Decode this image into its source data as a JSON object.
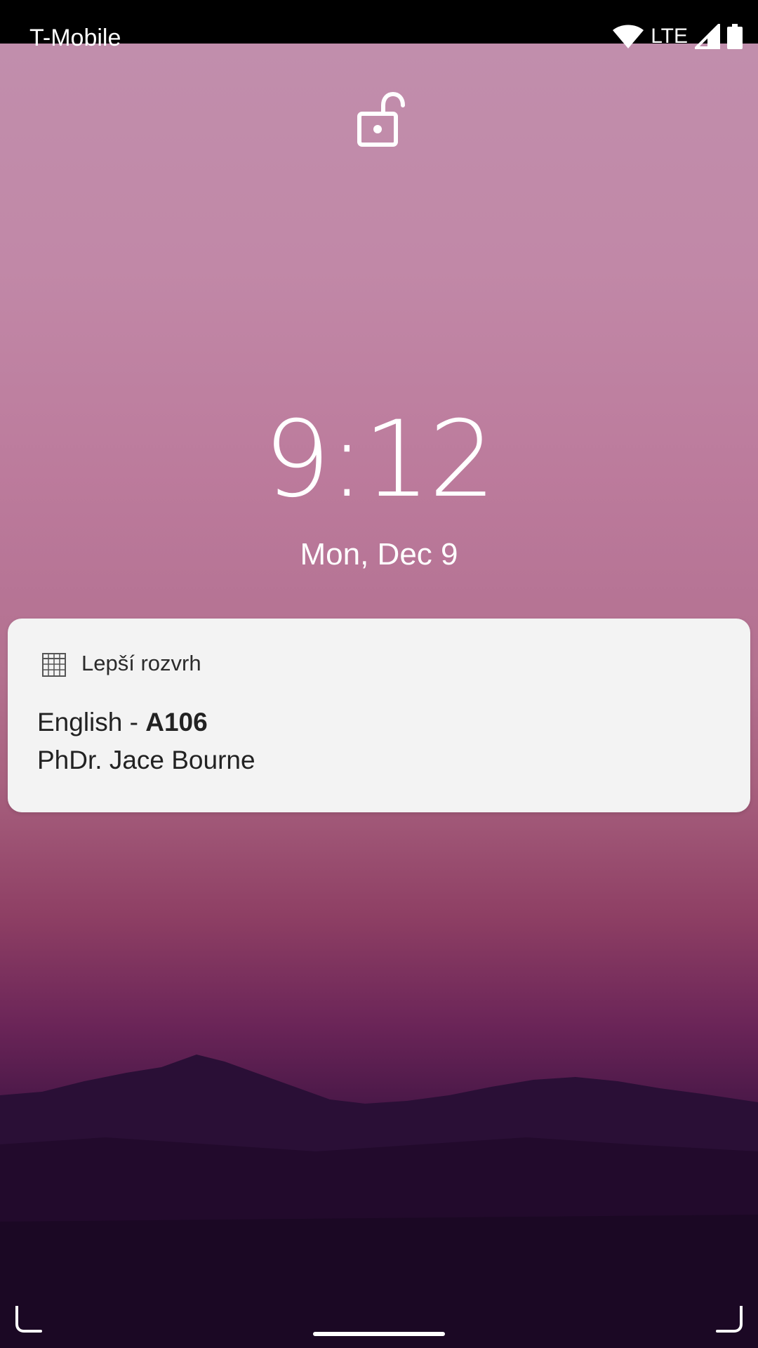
{
  "status_bar": {
    "carrier": "T-Mobile",
    "network_type": "LTE",
    "icons": [
      "wifi-icon",
      "cell-signal-icon",
      "battery-icon"
    ]
  },
  "lockscreen": {
    "lock_icon": "unlocked-padlock-icon",
    "time": "9:12",
    "date": "Mon, Dec 9"
  },
  "notification": {
    "app_icon": "calendar-grid-icon",
    "app_name": "Lepší rozvrh",
    "title_subject": "English - ",
    "title_room": "A106",
    "text": "PhDr. Jace Bourne"
  },
  "colors": {
    "card_background": "#f3f3f3",
    "status_bar": "#000000",
    "text_light": "#ffffff"
  }
}
